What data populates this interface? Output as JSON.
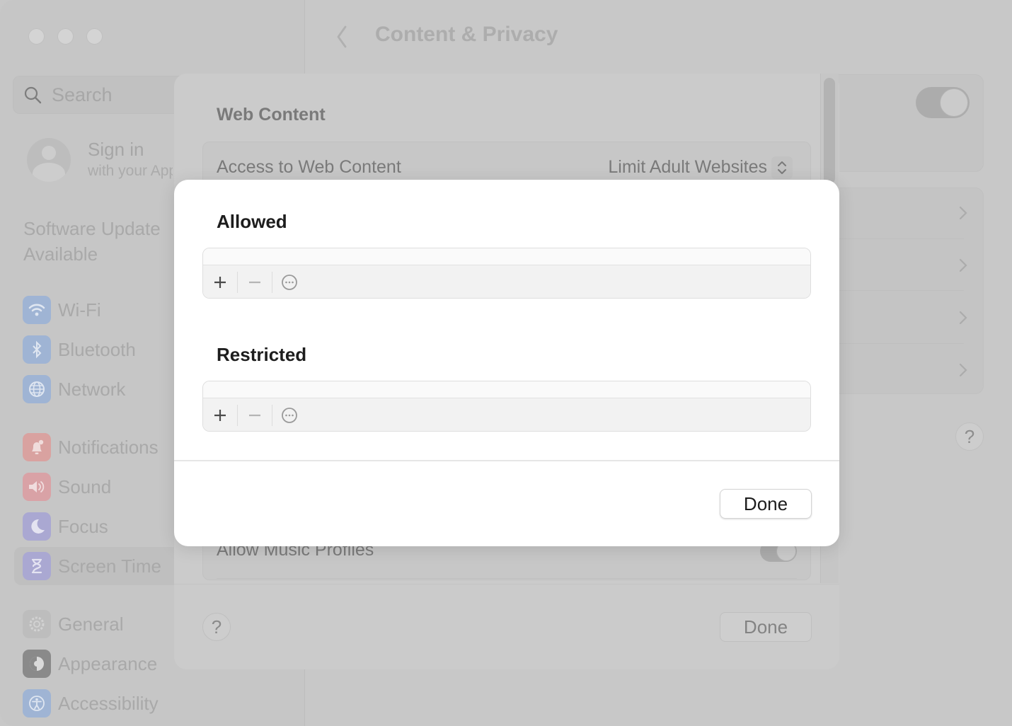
{
  "window": {
    "title": "Content & Privacy",
    "traffic_lights": [
      "close",
      "minimize",
      "zoom"
    ]
  },
  "sidebar": {
    "search_placeholder": "Search",
    "account": {
      "title": "Sign in",
      "subtitle": "with your Apple ID"
    },
    "software_update": "Software Update Available",
    "items": [
      {
        "label": "Wi-Fi",
        "icon": "wifi-icon",
        "color": "#9fb4d4"
      },
      {
        "label": "Bluetooth",
        "icon": "bluetooth-icon",
        "color": "#9fb4d4"
      },
      {
        "label": "Network",
        "icon": "globe-icon",
        "color": "#9fb4d4"
      },
      {
        "label": "Notifications",
        "icon": "bell-icon",
        "color": "#d9a2a0"
      },
      {
        "label": "Sound",
        "icon": "speaker-icon",
        "color": "#d9a2a6"
      },
      {
        "label": "Focus",
        "icon": "moon-icon",
        "color": "#aaa8d2"
      },
      {
        "label": "Screen Time",
        "icon": "hourglass-icon",
        "color": "#aaa8d2",
        "active": true
      },
      {
        "label": "General",
        "icon": "gear-icon",
        "color": "#bdbdbd"
      },
      {
        "label": "Appearance",
        "icon": "appearance-icon",
        "color": "#8a8a8a"
      },
      {
        "label": "Accessibility",
        "icon": "accessibility-icon",
        "color": "#9fb4d4"
      }
    ]
  },
  "sheet": {
    "section_title": "Web Content",
    "access_label": "Access to Web Content",
    "access_value": "Limit Adult Websites",
    "music_profiles_label": "Allow Music Profiles",
    "help_label": "?",
    "done_label": "Done"
  },
  "background_help": "?",
  "modal": {
    "allowed_title": "Allowed",
    "restricted_title": "Restricted",
    "toolbar": {
      "add": "+",
      "remove": "−",
      "more": "⋯"
    },
    "done_label": "Done"
  }
}
